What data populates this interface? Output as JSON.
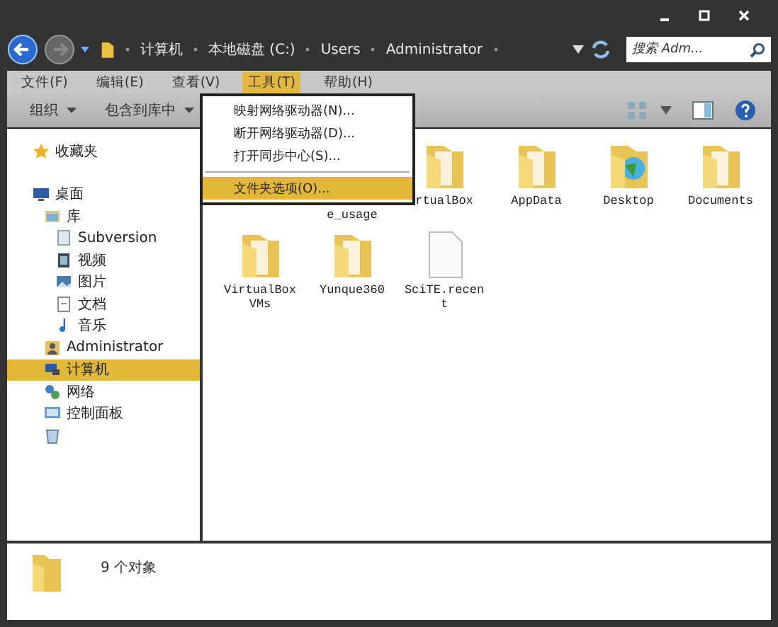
{
  "address": {
    "crumbs": [
      "计算机",
      "本地磁盘 (C:)",
      "Users",
      "Administrator"
    ]
  },
  "search": {
    "placeholder": "搜索 Adm..."
  },
  "menu_bar": [
    {
      "label": "文件(F)",
      "selected": false
    },
    {
      "label": "编辑(E)",
      "selected": false
    },
    {
      "label": "查看(V)",
      "selected": false
    },
    {
      "label": "工具(T)",
      "selected": true
    },
    {
      "label": "帮助(H)",
      "selected": false
    }
  ],
  "toolbar": [
    "组织",
    "包含到库中"
  ],
  "tools_menu": [
    {
      "kind": "item",
      "label": "映射网络驱动器(N)...",
      "selected": false
    },
    {
      "kind": "item",
      "label": "断开网络驱动器(D)...",
      "selected": false
    },
    {
      "kind": "item",
      "label": "打开同步中心(S)...",
      "selected": false
    },
    {
      "kind": "separator"
    },
    {
      "kind": "item",
      "label": "文件夹选项(O)...",
      "selected": true
    }
  ],
  "sidebar": [
    {
      "kind": "star",
      "label": "收藏夹",
      "selected": false
    },
    {
      "kind": "gap"
    },
    {
      "kind": "desktop",
      "label": "桌面",
      "selected": false,
      "children": [
        {
          "kind": "library",
          "label": "库",
          "selected": false,
          "children": [
            {
              "kind": "subversion",
              "label": "Subversion",
              "selected": false
            },
            {
              "kind": "video",
              "label": "视频",
              "selected": false
            },
            {
              "kind": "pictures",
              "label": "图片",
              "selected": false
            },
            {
              "kind": "docs",
              "label": "文档",
              "selected": false
            },
            {
              "kind": "music",
              "label": "音乐",
              "selected": false
            }
          ]
        },
        {
          "kind": "user",
          "label": "Administrator",
          "selected": false
        },
        {
          "kind": "computer",
          "label": "计算机",
          "selected": true
        },
        {
          "kind": "network",
          "label": "网络",
          "selected": false
        },
        {
          "kind": "controlpanel",
          "label": "控制面板",
          "selected": false
        },
        {
          "kind": "recycle",
          "selected": false
        }
      ]
    }
  ],
  "files": [
    {
      "kind": "covered"
    },
    {
      "kind": "covered",
      "label": "e_usage"
    },
    {
      "kind": "folder",
      "label": "rtualBox"
    },
    {
      "kind": "folder",
      "label": "AppData"
    },
    {
      "kind": "desktop",
      "label": "Desktop"
    },
    {
      "kind": "folder",
      "label": "Documents"
    },
    {
      "kind": "folder",
      "label": "VirtualBox VMs"
    },
    {
      "kind": "folder",
      "label": "Yunque360"
    },
    {
      "kind": "file",
      "label": "SciTE.recent"
    }
  ],
  "status_bar": {
    "text": "9 个对象"
  }
}
